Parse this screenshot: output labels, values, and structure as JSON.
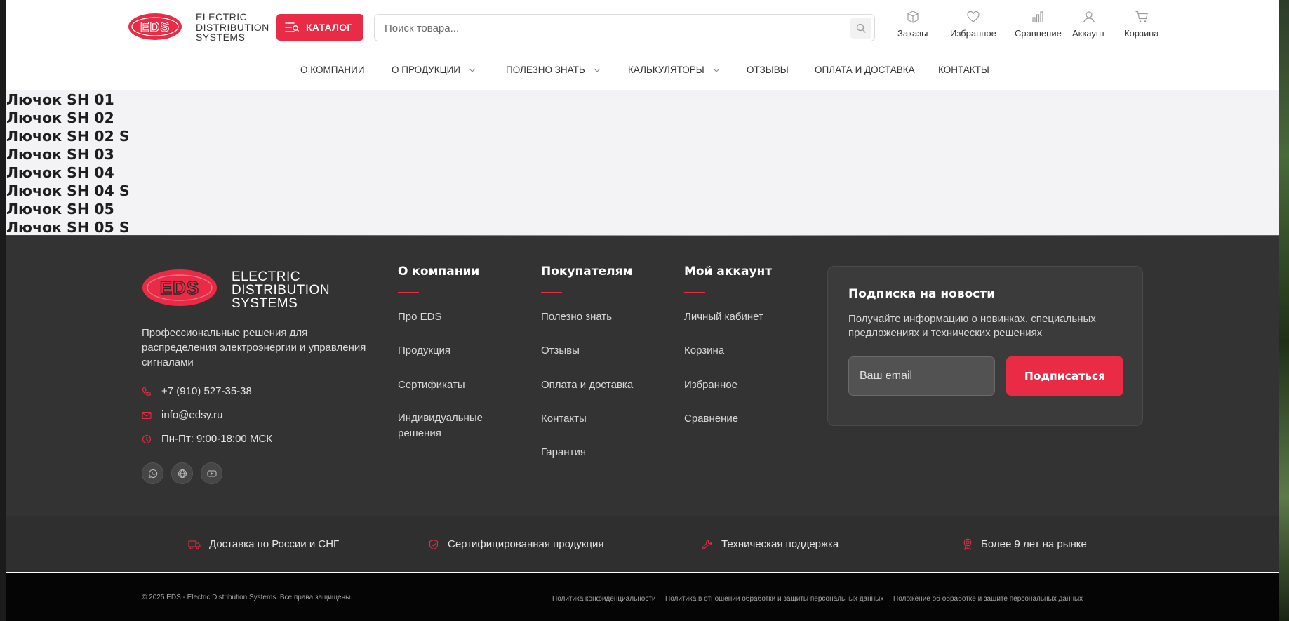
{
  "brand": {
    "logo_text": "EDS",
    "name_lines": [
      "ELECTRIC",
      "DISTRIBUTION",
      "SYSTEMS"
    ],
    "accent_color": "#ea2b45"
  },
  "header": {
    "catalog_label": "КАТАЛОГ",
    "search_placeholder": "Поиск товара...",
    "icons": [
      {
        "name": "orders-icon",
        "label": "Заказы"
      },
      {
        "name": "heart-icon",
        "label": "Избранное"
      },
      {
        "name": "compare-icon",
        "label": "Сравнение"
      },
      {
        "name": "user-icon",
        "label": "Аккаунт"
      },
      {
        "name": "cart-icon",
        "label": "Корзина"
      }
    ]
  },
  "nav": [
    {
      "label": "О КОМПАНИИ",
      "dropdown": false
    },
    {
      "label": "О ПРОДУКЦИИ",
      "dropdown": true
    },
    {
      "label": "ПОЛЕЗНО ЗНАТЬ",
      "dropdown": true
    },
    {
      "label": "КАЛЬКУЛЯТОРЫ",
      "dropdown": true
    },
    {
      "label": "ОТЗЫВЫ",
      "dropdown": false
    },
    {
      "label": "ОПЛАТА И ДОСТАВКА",
      "dropdown": false
    },
    {
      "label": "КОНТАКТЫ",
      "dropdown": false
    }
  ],
  "products": [
    "Лючок SH 01",
    "Лючок SH 02",
    "Лючок SH 02 S",
    "Лючок SH 03",
    "Лючок SH 04",
    "Лючок SH 04 S",
    "Лючок SH 05",
    "Лючок SH 05 S"
  ],
  "footer": {
    "description": "Профессиональные решения для распределения электроэнергии и управления сигналами",
    "phone": "+7 (910) 527-35-38",
    "email": "info@edsy.ru",
    "hours": "Пн-Пт: 9:00-18:00 МСК",
    "social": [
      "whatsapp-icon",
      "globe-icon",
      "youtube-icon"
    ],
    "columns": [
      {
        "title": "О компании",
        "links": [
          "Про EDS",
          "Продукция",
          "Сертификаты",
          "Индивидуальные решения"
        ]
      },
      {
        "title": "Покупателям",
        "links": [
          "Полезно знать",
          "Отзывы",
          "Оплата и доставка",
          "Контакты",
          "Гарантия"
        ]
      },
      {
        "title": "Мой аккаунт",
        "links": [
          "Личный кабинет",
          "Корзина",
          "Избранное",
          "Сравнение"
        ]
      }
    ],
    "subscribe": {
      "title": "Подписка на новости",
      "text": "Получайте информацию о новинках, специальных предложениях и технических решениях",
      "placeholder": "Ваш email",
      "button": "Подписаться"
    },
    "features": [
      {
        "icon": "truck-icon",
        "label": "Доставка по России и СНГ"
      },
      {
        "icon": "shield-check-icon",
        "label": "Сертифицированная продукция"
      },
      {
        "icon": "wrench-icon",
        "label": "Техническая поддержка"
      },
      {
        "icon": "award-icon",
        "label": "Более 9 лет на рынке"
      }
    ],
    "copyright": "© 2025 EDS - Electric Distribution Systems. Все права защищены.",
    "policies": [
      "Политика конфиденциальности",
      "Политика в отношении обработки и защиты персональных данных",
      "Положение об обработке и защите персональных данных"
    ]
  }
}
